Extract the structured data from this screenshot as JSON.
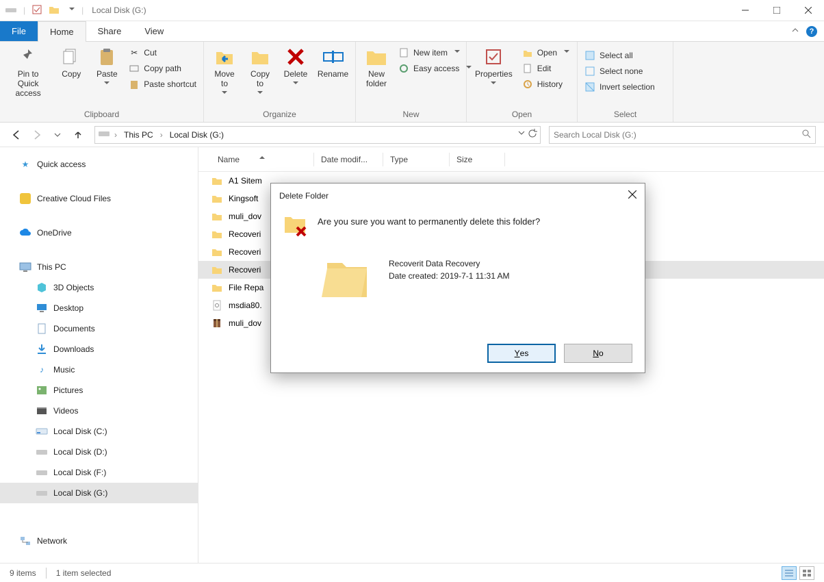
{
  "titlebar": {
    "title": "Local Disk (G:)"
  },
  "tabs": {
    "file": "File",
    "home": "Home",
    "share": "Share",
    "view": "View"
  },
  "ribbon": {
    "clipboard": {
      "label": "Clipboard",
      "pin": "Pin to Quick\naccess",
      "copy": "Copy",
      "paste": "Paste",
      "cut": "Cut",
      "copypath": "Copy path",
      "pasteshort": "Paste shortcut"
    },
    "organize": {
      "label": "Organize",
      "moveto": "Move\nto",
      "copyto": "Copy\nto",
      "delete": "Delete",
      "rename": "Rename"
    },
    "new": {
      "label": "New",
      "newfolder": "New\nfolder",
      "newitem": "New item",
      "easyaccess": "Easy access"
    },
    "open": {
      "label": "Open",
      "properties": "Properties",
      "open": "Open",
      "edit": "Edit",
      "history": "History"
    },
    "select": {
      "label": "Select",
      "selectall": "Select all",
      "selectnone": "Select none",
      "invert": "Invert selection"
    }
  },
  "breadcrumb": {
    "pc": "This PC",
    "loc": "Local Disk (G:)"
  },
  "search": {
    "placeholder": "Search Local Disk (G:)"
  },
  "columns": {
    "name": "Name",
    "date": "Date modif...",
    "type": "Type",
    "size": "Size"
  },
  "tree": {
    "quick": "Quick access",
    "cc": "Creative Cloud Files",
    "onedrive": "OneDrive",
    "thispc": "This PC",
    "obj3d": "3D Objects",
    "desktop": "Desktop",
    "documents": "Documents",
    "downloads": "Downloads",
    "music": "Music",
    "pictures": "Pictures",
    "videos": "Videos",
    "ldc": "Local Disk (C:)",
    "ldd": "Local Disk (D:)",
    "ldf": "Local Disk (F:)",
    "ldg": "Local Disk (G:)",
    "network": "Network"
  },
  "files": {
    "f0": "A1 Sitem",
    "f1": "Kingsoft",
    "f2": "muli_dov",
    "f3": "Recoveri",
    "f4": "Recoveri",
    "f5": "Recoveri",
    "f6": "File Repa",
    "f7": "msdia80.",
    "f8": "muli_dov"
  },
  "status": {
    "count": "9 items",
    "sel": "1 item selected"
  },
  "dialog": {
    "title": "Delete Folder",
    "msg": "Are you sure you want to permanently delete this folder?",
    "name": "Recoverit Data Recovery",
    "date": "Date created: 2019-7-1 11:31 AM",
    "yes": "es",
    "no": "o"
  }
}
